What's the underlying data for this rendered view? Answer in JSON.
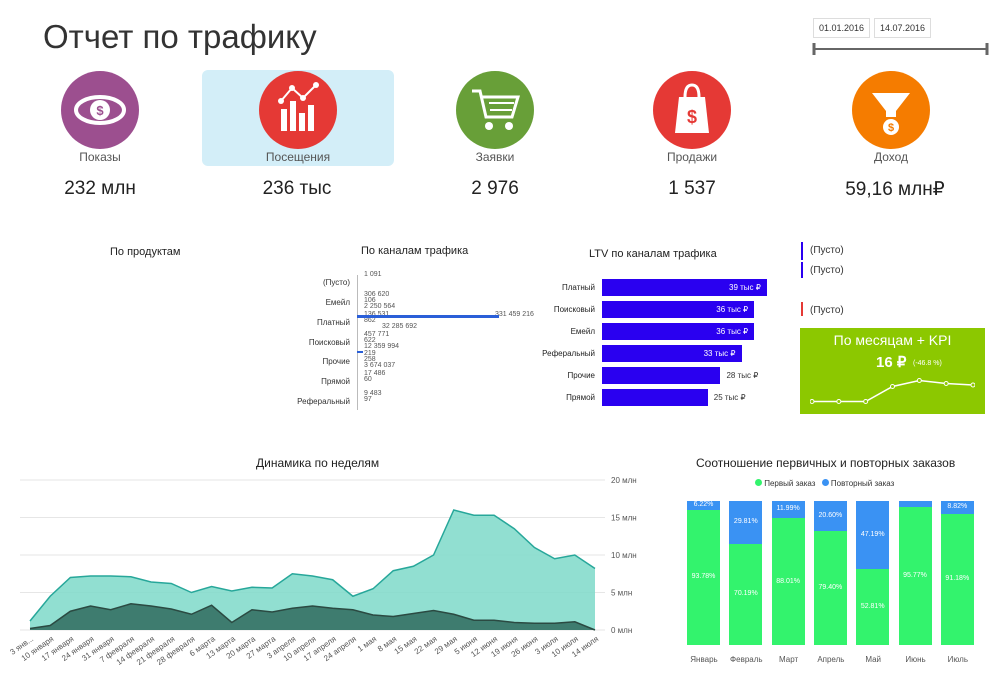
{
  "title": "Отчет по трафику",
  "date_range": {
    "start": "01.01.2016",
    "end": "14.07.2016"
  },
  "kpis": [
    {
      "label": "Показы",
      "value": "232 млн",
      "icon": "eye-money-icon",
      "color": "#9c4f8f"
    },
    {
      "label": "Посещения",
      "value": "236 тыс",
      "icon": "bar-chart-icon",
      "color": "#e53935"
    },
    {
      "label": "Заявки",
      "value": "2 976",
      "icon": "cart-icon",
      "color": "#689f38"
    },
    {
      "label": "Продажи",
      "value": "1 537",
      "icon": "bag-icon",
      "color": "#e53935"
    },
    {
      "label": "Доход",
      "value": "59,16 млн₽",
      "icon": "funnel-icon",
      "color": "#f57c00"
    }
  ],
  "sections": {
    "products_title": "По продуктам",
    "channels_title": "По каналам трафика",
    "ltv_title": "LTV по каналам трафика",
    "weekly_title": "Динамика по неделям",
    "orders_title": "Соотношение первичных и повторных заказов"
  },
  "channels": {
    "categories": [
      "(Пусто)",
      "Емейл",
      "Платный",
      "Поисковый",
      "Прочие",
      "Прямой",
      "Реферальный"
    ],
    "labels": [
      [
        "1 091"
      ],
      [
        "306 620",
        "106",
        "2 250 564"
      ],
      [
        "136 531",
        "862",
        "32 285 692",
        "331 459 216"
      ],
      [
        "457 771",
        "622",
        "12 359 994"
      ],
      [
        "219",
        "258",
        "3 674 037"
      ],
      [
        "17 486",
        "60"
      ],
      [
        "9 483",
        "97"
      ]
    ]
  },
  "ltv": {
    "categories": [
      "Платный",
      "Поисковый",
      "Емейл",
      "Реферальный",
      "Прочие",
      "Прямой"
    ],
    "values": [
      39,
      36,
      36,
      33,
      28,
      25
    ],
    "labels": [
      "39 тыс ₽",
      "36 тыс ₽",
      "36 тыс ₽",
      "33 тыс ₽",
      "28 тыс ₽",
      "25 тыс ₽"
    ]
  },
  "legend": [
    {
      "label": "(Пусто)",
      "color": "#2a00f0"
    },
    {
      "label": "(Пусто)",
      "color": "#2a00f0"
    },
    {
      "label": "(Пусто)",
      "color": "#e53935"
    }
  ],
  "kpi_box": {
    "title": "По месяцам + KPI",
    "value": "16 ₽",
    "delta": "(-46.8 %)",
    "background": "#8cc800",
    "sparkline": [
      0.15,
      0.15,
      0.15,
      0.65,
      0.85,
      0.75,
      0.7
    ]
  },
  "chart_data": [
    {
      "type": "area",
      "title": "Динамика по неделям",
      "x": [
        "3 янв...",
        "10 января",
        "17 января",
        "24 января",
        "31 января",
        "7 февраля",
        "14 февраля",
        "21 февраля",
        "28 февраля",
        "6 марта",
        "13 марта",
        "20 марта",
        "27 марта",
        "3 апреля",
        "10 апреля",
        "17 апреля",
        "24 апреля",
        "1 мая",
        "8 мая",
        "15 мая",
        "22 мая",
        "29 мая",
        "5 июня",
        "12 июня",
        "19 июня",
        "26 июня",
        "3 июля",
        "10 июля",
        "14 июля"
      ],
      "yticks": [
        "20 млн",
        "15 млн",
        "10 млн",
        "5 млн",
        "0 млн"
      ],
      "ylim": [
        0,
        20
      ],
      "series": [
        {
          "values": [
            1.2,
            4.5,
            7.0,
            7.2,
            7.2,
            7.1,
            6.4,
            6.2,
            5.0,
            5.8,
            5.2,
            5.7,
            5.6,
            7.5,
            7.2,
            6.7,
            4.5,
            5.5,
            7.9,
            8.5,
            10.0,
            16.0,
            15.3,
            15.3,
            13.5,
            11.0,
            9.5,
            10.0,
            8.2
          ],
          "color": "#7ed9c9"
        },
        {
          "values": [
            0.2,
            0.6,
            2.5,
            3.2,
            2.7,
            3.5,
            3.2,
            2.8,
            2.1,
            3.3,
            1.0,
            2.7,
            2.4,
            2.9,
            3.2,
            2.9,
            2.7,
            2.0,
            1.8,
            2.2,
            2.6,
            2.1,
            1.3,
            1.3,
            1.0,
            0.9,
            0.9,
            1.1,
            0.0
          ],
          "color": "#2f6b5e"
        }
      ]
    },
    {
      "type": "bar",
      "title": "Соотношение первичных и повторных заказов",
      "categories": [
        "Январь",
        "Февраль",
        "Март",
        "Апрель",
        "Май",
        "Июнь",
        "Июль"
      ],
      "series": [
        {
          "name": "Первый заказ",
          "color": "#33f36d",
          "values": [
            93.78,
            70.19,
            88.01,
            79.4,
            52.81,
            95.77,
            91.18
          ],
          "labels": [
            "93.78%",
            "70.19%",
            "88.01%",
            "79.40%",
            "52.81%",
            "95.77%",
            "91.18%"
          ]
        },
        {
          "name": "Повторный заказ",
          "color": "#3a92f3",
          "values": [
            6.22,
            29.81,
            11.99,
            20.6,
            47.19,
            4.23,
            8.82
          ],
          "labels": [
            "6.22%",
            "29.81%",
            "11.99%",
            "20.60%",
            "47.19%",
            "",
            "8.82%"
          ]
        }
      ]
    }
  ]
}
